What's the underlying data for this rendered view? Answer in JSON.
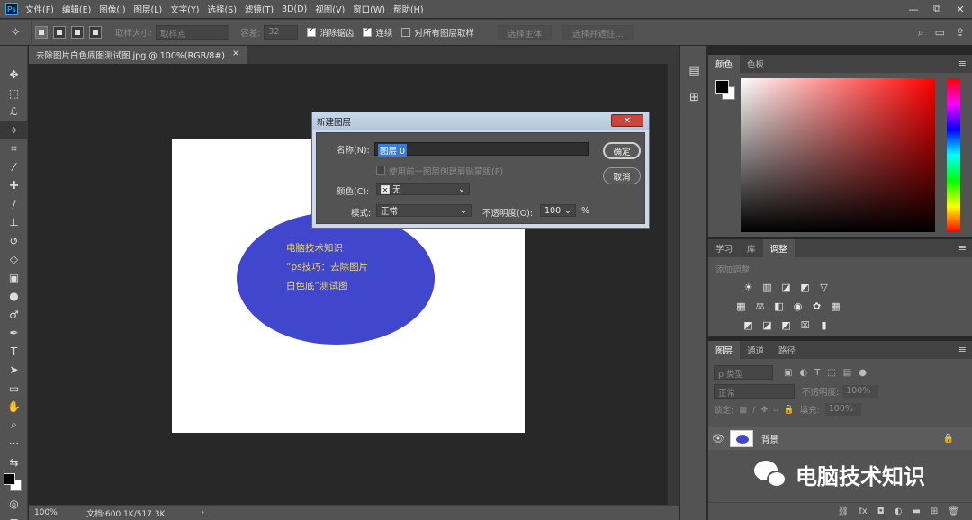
{
  "app": {
    "logo": "Ps"
  },
  "menu": [
    "文件(F)",
    "编辑(E)",
    "图像(I)",
    "图层(L)",
    "文字(Y)",
    "选择(S)",
    "滤镜(T)",
    "3D(D)",
    "视图(V)",
    "窗口(W)",
    "帮助(H)"
  ],
  "window_controls": [
    "—",
    "⧉",
    "✕"
  ],
  "options": {
    "sample_size_label": "取样大小:",
    "sample_size_value": "取样点",
    "tolerance_label": "容差:",
    "tolerance_value": "32",
    "antialias_label": "消除锯齿",
    "contiguous_label": "连续",
    "all_layers_label": "对所有图层取样",
    "select_subject": "选择主体",
    "select_mask": "选择并遮住..."
  },
  "document": {
    "tab_title": "去除图片白色底图测试图.jpg @ 100%(RGB/8#)",
    "tab_close": "×",
    "canvas_text": [
      "电脑技术知识",
      "“ps技巧：去除图片",
      "白色底”测试图"
    ]
  },
  "status": {
    "zoom": "100%",
    "doc_info": "文档:600.1K/517.3K",
    "arrow": "›"
  },
  "color_panel": {
    "tabs": [
      "颜色",
      "色板"
    ]
  },
  "adjust_panel": {
    "tabs": [
      "学习",
      "库",
      "调整"
    ],
    "title": "添加调整"
  },
  "layers_panel": {
    "tabs": [
      "图层",
      "通道",
      "路径"
    ],
    "filter_label": "ρ 类型",
    "blend_mode": "正常",
    "opacity_label": "不透明度:",
    "opacity_value": "100%",
    "lock_label": "锁定:",
    "fill_label": "填充:",
    "fill_value": "100%",
    "layer_name": "背景"
  },
  "dialog": {
    "title": "新建图层",
    "close": "✕",
    "name_label": "名称(N):",
    "name_value": "图层 0",
    "clip_label": "使用前一图层创建剪贴蒙版(P)",
    "color_label": "颜色(C):",
    "color_value": "无",
    "mode_label": "模式:",
    "mode_value": "正常",
    "opacity_label": "不透明度(O):",
    "opacity_value": "100",
    "percent": "%",
    "ok": "确定",
    "cancel": "取消"
  },
  "watermark": {
    "text": "电脑技术知识"
  },
  "colors": {
    "accent_blue": "#4147cc",
    "canvas_text": "#f2d85a",
    "selection": "#3a7bd5"
  },
  "icons": [
    "ps-logo-icon",
    "magic-wand-icon",
    "move-icon",
    "marquee-icon",
    "lasso-icon",
    "crop-icon",
    "eyedropper-icon",
    "brush-icon",
    "stamp-icon",
    "eraser-icon",
    "gradient-icon",
    "pen-icon",
    "type-icon",
    "hand-icon",
    "zoom-icon",
    "search-icon",
    "eye-icon",
    "lock-icon"
  ]
}
